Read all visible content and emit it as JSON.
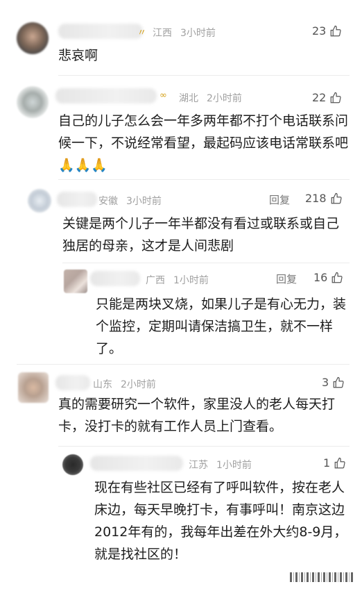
{
  "comments": [
    {
      "location": "江西",
      "time": "3小时前",
      "likes": "23",
      "text": "悲哀啊",
      "badge": "〃"
    },
    {
      "location": "湖北",
      "time": "2小时前",
      "likes": "22",
      "text": "自己的儿子怎么会一年多两年都不打个电话联系问候一下，不说经常看望，最起码应该电话常联系吧🙏🙏🙏",
      "badge": "∞"
    },
    {
      "location": "安徽",
      "time": "3小时前",
      "reply_label": "回复",
      "likes": "218",
      "text": "关键是两个儿子一年半都没有看过或联系或自己独居的母亲，这才是人间悲剧"
    },
    {
      "location": "广西",
      "time": "1小时前",
      "reply_label": "回复",
      "likes": "16",
      "text": "只能是两块叉烧，如果儿子是有心无力，装个监控，定期叫请保洁搞卫生，就不一样了。"
    },
    {
      "location": "山东",
      "time": "2小时前",
      "likes": "3",
      "text": "真的需要研究一个软件，家里没人的老人每天打卡，没打卡的就有工作人员上门查看。"
    },
    {
      "location": "江苏",
      "time": "1小时前",
      "likes": "1",
      "text": "现在有些社区已经有了呼叫软件，按在老人床边，每天早晚打卡，有事呼叫！南京这边2012年有的，我每年出差在外大约8-9月，就是找社区的！"
    }
  ],
  "icons": {
    "like": "thumbs-up-icon"
  }
}
